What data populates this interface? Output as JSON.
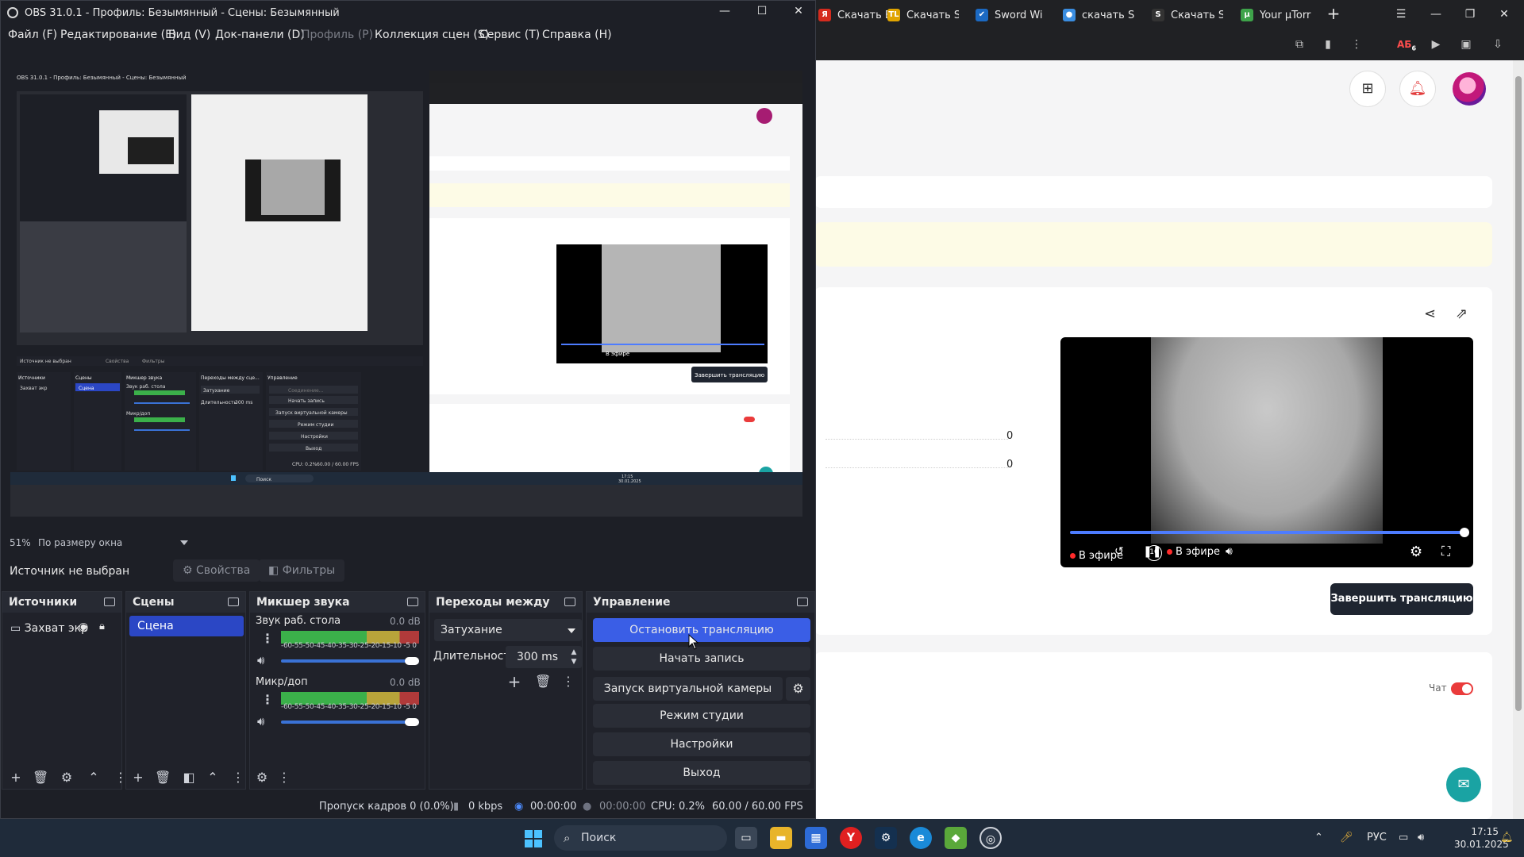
{
  "browser": {
    "tabs": [
      {
        "label": "Скачать Е",
        "icon": "yandex-icon",
        "color": "#d52b1e"
      },
      {
        "label": "Скачать S",
        "icon": "tl-icon",
        "color": "#e0a400"
      },
      {
        "label": "Sword Wi",
        "icon": "steam-icon",
        "color": "#1b69c2"
      },
      {
        "label": "скачать S",
        "icon": "chat-icon",
        "color": "#3a8de0"
      },
      {
        "label": "Скачать S",
        "icon": "s-icon",
        "color": "#333333"
      },
      {
        "label": "Your μTorr",
        "icon": "utorrent-icon",
        "color": "#3ea34a"
      }
    ],
    "toolbar_badge": "АБ",
    "toolbar_badge_count": "6",
    "video": {
      "live_label": "В эфире",
      "live_label2": "В эфире",
      "skip_label": "10"
    },
    "finish_button": "Завершить трансляцию",
    "zero_values": [
      "0",
      "0"
    ],
    "chat_label": "Чат",
    "colors": {
      "accent": "#4d7cff",
      "toggle": "#ea3b3b",
      "fab": "#1aa3a3"
    }
  },
  "obs": {
    "title": "OBS 31.0.1 - Профиль: Безымянный - Сцены: Безымянный",
    "menu": [
      {
        "label": "Файл (F)",
        "enabled": true
      },
      {
        "label": "Редактирование (E)",
        "enabled": true
      },
      {
        "label": "Вид (V)",
        "enabled": true
      },
      {
        "label": "Док-панели (D)",
        "enabled": true
      },
      {
        "label": "Профиль (P)",
        "enabled": false
      },
      {
        "label": "Коллекция сцен (S)",
        "enabled": true
      },
      {
        "label": "Сервис (T)",
        "enabled": true
      },
      {
        "label": "Справка (H)",
        "enabled": true
      }
    ],
    "zoom": "51%",
    "zoom_mode": "По размеру окна",
    "source_status": "Источник не выбран",
    "properties_label": "Свойства",
    "filters_label": "Фильтры",
    "docks": {
      "sources": {
        "title": "Источники",
        "items": [
          {
            "label": "Захват экр"
          }
        ]
      },
      "scenes": {
        "title": "Сцены",
        "items": [
          {
            "label": "Сцена",
            "selected": true
          }
        ]
      },
      "mixer": {
        "title": "Микшер звука",
        "channels": [
          {
            "name": "Звук раб. стола",
            "db": "0.0 dB",
            "volume": 1.0
          },
          {
            "name": "Микр/доп",
            "db": "0.0 dB",
            "volume": 1.0
          }
        ],
        "ticks": "-60-55-50-45-40-35-30-25-20-15-10 -5  0"
      },
      "transitions": {
        "title": "Переходы между сце...",
        "type": "Затухание",
        "duration_label": "Длительность",
        "duration": "300 ms"
      },
      "controls": {
        "title": "Управление",
        "buttons": [
          "Остановить трансляцию",
          "Начать запись",
          "Запуск виртуальной камеры",
          "Режим студии",
          "Настройки",
          "Выход"
        ]
      }
    },
    "status": {
      "dropped": "Пропуск кадров 0 (0.0%)",
      "kbps": "0 kbps",
      "stream_time": "00:00:00",
      "rec_time": "00:00:00",
      "cpu": "CPU: 0.2%",
      "fps": "60.00 / 60.00 FPS"
    },
    "colors": {
      "primary": "#3a5ee6",
      "selected": "#2b47c5",
      "bg": "#1d1f26"
    }
  },
  "nested_preview": {
    "title": "OBS 31.0.1 - Профиль: Безымянный - Сцены: Безымянный",
    "source_status": "Источник не выбран",
    "properties": "Свойства",
    "filters": "Фильтры",
    "sources": "Источники",
    "scenes": "Сцены",
    "mixer": "Микшер звука",
    "transitions": "Переходы между сце...",
    "controls": "Управление",
    "scene": "Сцена",
    "capture": "Захват экр",
    "desktop_audio": "Звук раб. стола",
    "mic": "Микр/доп",
    "fade": "Затухание",
    "duration": "Длительность",
    "duration_val": "300 ms",
    "connecting": "Соединение...",
    "buttons": [
      "Начать запись",
      "Запуск виртуальной камеры",
      "Режим студии",
      "Настройки",
      "Выход"
    ],
    "finish": "Завершить трансляцию",
    "live": "В эфире",
    "search": "Поиск",
    "status": "CPU: 0.2%",
    "fps": "60.00 / 60.00 FPS",
    "clock_time": "17:15",
    "clock_date": "30.01.2025"
  },
  "taskbar": {
    "search_placeholder": "Поиск",
    "lang": "РУС",
    "time": "17:15",
    "date": "30.01.2025"
  }
}
